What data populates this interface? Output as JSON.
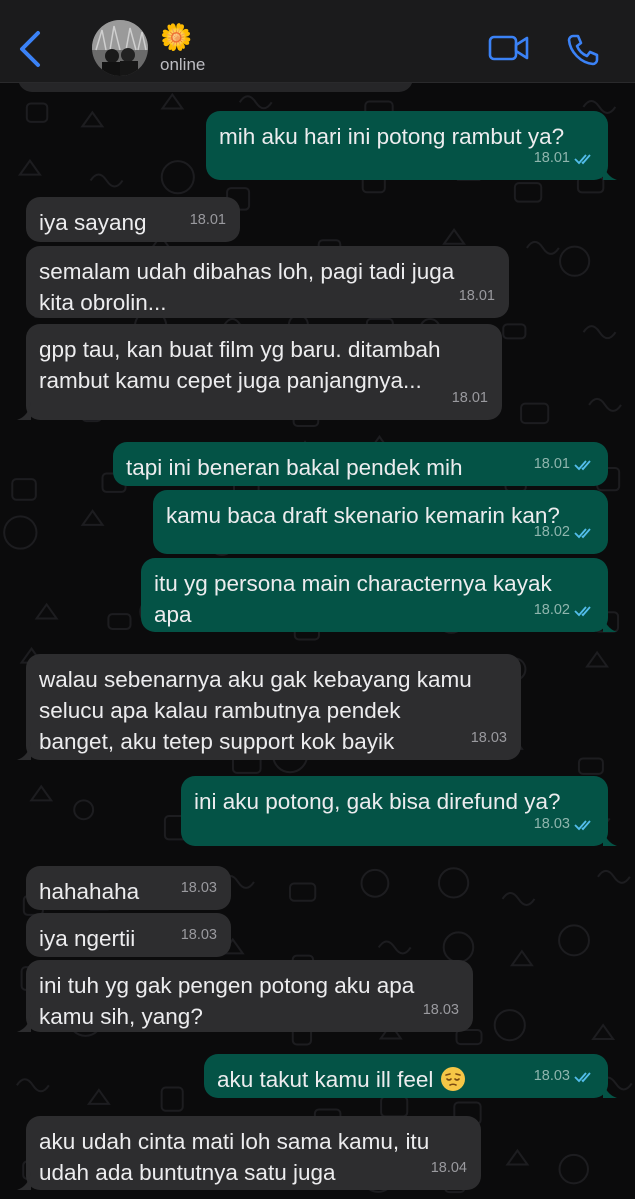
{
  "header": {
    "contact_name": "🌼",
    "status": "online",
    "accent_color": "#3b82f6"
  },
  "messages": [
    {
      "dir": "out",
      "text": "mih aku hari ini potong rambut ya?",
      "time": "18.01",
      "read": true
    },
    {
      "dir": "in",
      "text": "iya sayang",
      "time": "18.01"
    },
    {
      "dir": "in",
      "text": "semalam udah dibahas loh, pagi tadi juga\nkita obrolin...",
      "time": "18.01"
    },
    {
      "dir": "in",
      "text": "gpp tau, kan buat film yg baru. ditambah\nrambut kamu cepet juga panjangnya...",
      "time": "18.01"
    },
    {
      "dir": "out",
      "text": "tapi ini beneran bakal pendek mih",
      "time": "18.01",
      "read": true
    },
    {
      "dir": "out",
      "text": "kamu baca draft skenario kemarin kan?",
      "time": "18.02",
      "read": true
    },
    {
      "dir": "out",
      "text": "itu yg persona main characternya kayak\napa",
      "time": "18.02",
      "read": true
    },
    {
      "dir": "in",
      "text": "walau sebenarnya aku gak kebayang kamu\nselucu apa kalau rambutnya pendek\nbanget, aku tetep support kok bayik",
      "time": "18.03"
    },
    {
      "dir": "out",
      "text": "ini aku potong, gak bisa direfund ya?",
      "time": "18.03",
      "read": true
    },
    {
      "dir": "in",
      "text": "hahahaha",
      "time": "18.03"
    },
    {
      "dir": "in",
      "text": "iya ngertii",
      "time": "18.03"
    },
    {
      "dir": "in",
      "text": "ini tuh yg gak pengen potong aku apa\nkamu sih, yang?",
      "time": "18.03"
    },
    {
      "dir": "out",
      "text": "aku takut kamu ill feel",
      "emoji": "pensive-face",
      "time": "18.03",
      "read": true
    },
    {
      "dir": "in",
      "text": "aku udah cinta mati loh sama kamu, itu\nudah ada buntutnya satu juga",
      "time": "18.04"
    }
  ]
}
